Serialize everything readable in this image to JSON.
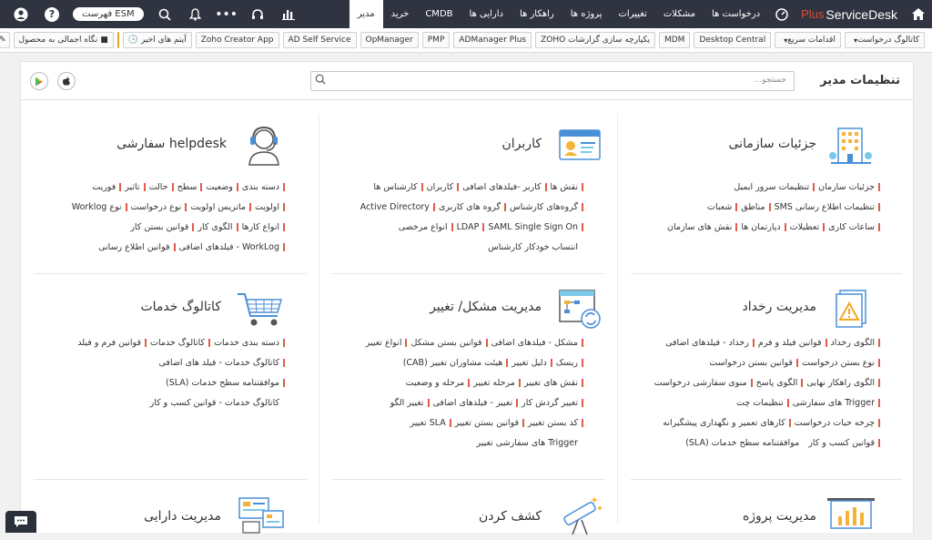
{
  "app": {
    "name": "ServiceDesk",
    "plus": "Plus"
  },
  "nav": {
    "items": [
      {
        "label": "درخواست ها"
      },
      {
        "label": "مشکلات"
      },
      {
        "label": "تغییرات"
      },
      {
        "label": "پروژه ها"
      },
      {
        "label": "راهکار ها"
      },
      {
        "label": "دارایی ها"
      },
      {
        "label": "CMDB"
      },
      {
        "label": "خرید"
      },
      {
        "label": "مدیر"
      }
    ],
    "esm": "فهرست ESM",
    "help": "?",
    "more": "•••"
  },
  "toolbar": {
    "items": [
      {
        "label": "کاتالوگ درخواست",
        "dropdown": true
      },
      {
        "label": "اقدامات سریع",
        "dropdown": true
      },
      {
        "label": "Desktop Central"
      },
      {
        "label": "MDM"
      },
      {
        "label": "یکپارچه سازی گزارشات ZOHO"
      },
      {
        "label": "ADManager Plus"
      },
      {
        "label": "PMP"
      },
      {
        "label": "OpManager"
      },
      {
        "label": "AD Self Service"
      },
      {
        "label": "Zoho Creator App"
      },
      {
        "label": "آیتم های اخیر"
      }
    ],
    "overview": "نگاه اجمالی به محصول"
  },
  "admin": {
    "title": "تنظیمات مدیر",
    "search_placeholder": "جستجو..."
  },
  "cards": {
    "org": {
      "title": "جزئیات سازمانی",
      "rows": [
        [
          "جزئیات سازمان",
          "تنظیمات سرور ایمیل"
        ],
        [
          "تنظیمات اطلاع رسانی SMS",
          "مناطق",
          "شعبات"
        ],
        [
          "ساعات کاری",
          "تعطیلات",
          "دپارتمان ها",
          "نقش های سازمان"
        ]
      ]
    },
    "users": {
      "title": "کاربران",
      "rows": [
        [
          "نقش ها",
          "کاربر -فیلدهای اضافی",
          "کاربران",
          "کارشناس ها"
        ],
        [
          "گروه‌های کارشناس",
          "گروه های کاربری",
          "Active Directory"
        ],
        [
          "LDAP",
          "SAML Single Sign On",
          "انواع مرخصی"
        ],
        [
          "انتساب خودکار کارشناس"
        ]
      ]
    },
    "helpdesk": {
      "title": "helpdesk سفارشی",
      "rows": [
        [
          "دسته بندی",
          "وضعیت",
          "سطح",
          "حالت",
          "تاثیر",
          "فوریت"
        ],
        [
          "اولویت",
          "ماتریس اولویت",
          "نوع درخواست",
          "نوع Worklog"
        ],
        [
          "انواع کارها",
          "الگوی کار",
          "قوانین بستن کار"
        ],
        [
          "WorkLog - فیلدهای اضافی",
          "قوانین اطلاع رسانی"
        ]
      ]
    },
    "incident": {
      "title": "مدیریت رخداد",
      "rows": [
        [
          "الگوی رخداد",
          "قوانین فیلد و فرم",
          "رخداد - فیلدهای اضافی"
        ],
        [
          "نوع بستن درخواست",
          "قوانین بستن درخواست"
        ],
        [
          "الگوی راهکار نهایی",
          "الگوی پاسخ",
          "منوی سفارشی درخواست"
        ],
        [
          "Trigger های سفارشی",
          "تنظیمات چت"
        ],
        [
          "چرخه حیات درخواست",
          "کارهای تعمیر و نگهداری پیشگیرانه"
        ],
        [
          "قوانین کسب و کار",
          "موافقتنامه سطح خدمات (SLA)"
        ]
      ]
    },
    "problem": {
      "title": "مدیریت مشکل/ تغییر",
      "rows": [
        [
          "مشکل - فیلدهای اضافی",
          "قوانین بستن مشکل",
          "انواع تغییر"
        ],
        [
          "ریسک",
          "دلیل تغییر",
          "هیئت مشاوران تغییر (CAB)"
        ],
        [
          "نقش های تغییر",
          "مرحله تغییر",
          "مرحله و وضعیت"
        ],
        [
          "تغییر گردش کار",
          "تغییر - فیلدهای اضافی",
          "تغییر الگو"
        ],
        [
          "کد بستن تغییر",
          "قوانین بستن تغییر",
          "SLA تغییر"
        ],
        [
          "Trigger های سفارشی تغییر"
        ]
      ]
    },
    "catalog": {
      "title": "کاتالوگ خدمات",
      "rows": [
        [
          "دسته بندی خدمات",
          "کاتالوگ خدمات",
          "قوانین فرم و فیلد"
        ],
        [
          "کاتالوگ خدمات - فیلد های اضافی"
        ],
        [
          "موافقتنامه سطح خدمات (SLA)"
        ],
        [
          "کاتالوگ خدمات - قوانین کسب و کار"
        ]
      ]
    },
    "project": {
      "title": "مدیریت پروژه"
    },
    "discovery": {
      "title": "کشف کردن"
    },
    "asset": {
      "title": "مدیریت دارایی"
    }
  }
}
